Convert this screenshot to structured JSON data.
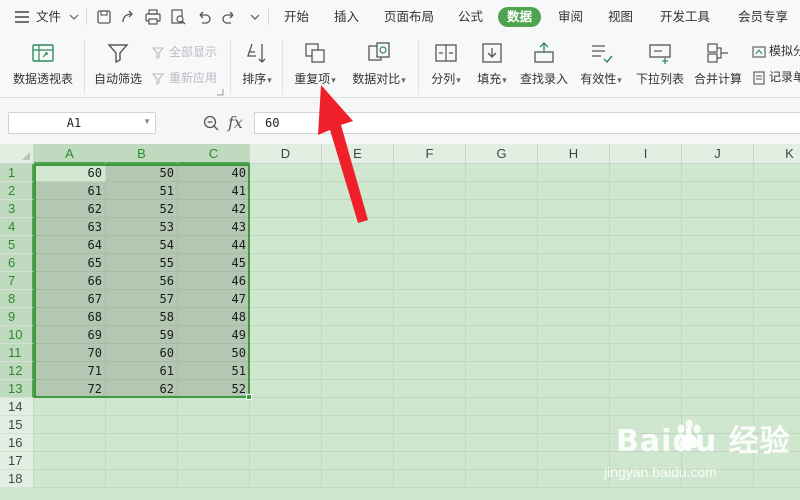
{
  "menubar": {
    "file_label": "文件",
    "tabs": [
      {
        "label": "开始"
      },
      {
        "label": "插入"
      },
      {
        "label": "页面布局"
      },
      {
        "label": "公式"
      },
      {
        "label": "数据",
        "active": true
      },
      {
        "label": "审阅"
      },
      {
        "label": "视图"
      },
      {
        "label": "开发工具"
      },
      {
        "label": "会员专享"
      }
    ]
  },
  "ribbon": {
    "pivot": "数据透视表",
    "autofilter": "自动筛选",
    "show_all": "全部显示",
    "reapply": "重新应用",
    "sort": "排序",
    "duplicates": "重复项",
    "compare": "数据对比",
    "split": "分列",
    "fill": "填充",
    "lookup": "查找录入",
    "validity": "有效性",
    "dropdown": "下拉列表",
    "consolidate": "合并计算",
    "simulate": "模拟分",
    "record": "记录单"
  },
  "formula_bar": {
    "name_box": "A1",
    "fx_label": "fx",
    "formula": "60"
  },
  "sheet": {
    "columns": [
      "A",
      "B",
      "C",
      "D",
      "E",
      "F",
      "G",
      "H",
      "I",
      "J",
      "K"
    ],
    "rows": [
      "1",
      "2",
      "3",
      "4",
      "5",
      "6",
      "7",
      "8",
      "9",
      "10",
      "11",
      "12",
      "13",
      "14",
      "15",
      "16",
      "17",
      "18"
    ],
    "data": [
      [
        "60",
        "50",
        "40"
      ],
      [
        "61",
        "51",
        "41"
      ],
      [
        "62",
        "52",
        "42"
      ],
      [
        "63",
        "53",
        "43"
      ],
      [
        "64",
        "54",
        "44"
      ],
      [
        "65",
        "55",
        "45"
      ],
      [
        "66",
        "56",
        "46"
      ],
      [
        "67",
        "57",
        "47"
      ],
      [
        "68",
        "58",
        "48"
      ],
      [
        "69",
        "59",
        "49"
      ],
      [
        "70",
        "60",
        "50"
      ],
      [
        "71",
        "61",
        "51"
      ],
      [
        "72",
        "62",
        "52"
      ]
    ]
  },
  "watermark": {
    "brand": "Baidu 经验",
    "url": "jingyan.baidu.com"
  },
  "colors": {
    "accent": "#4ea34e",
    "grid_bg": "#cfe6cf",
    "selection": "#b3c7b3",
    "arrow": "#f0202a"
  }
}
